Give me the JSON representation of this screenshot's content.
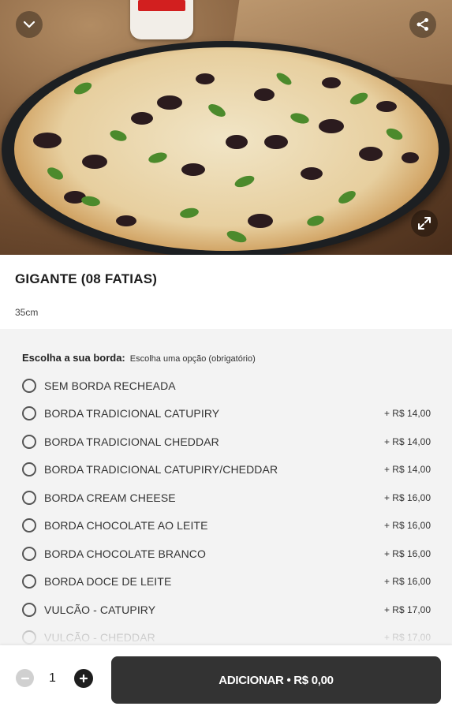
{
  "hero": {
    "image_alt": "Pizza",
    "back_icon": "chevron-down-icon",
    "share_icon": "share-icon",
    "expand_icon": "expand-icon"
  },
  "product": {
    "title": "GIGANTE (08 FATIAS)",
    "description": "35cm"
  },
  "option_group": {
    "title": "Escolha a sua borda:",
    "subtitle": "Escolha uma opção (obrigatório)",
    "options": [
      {
        "label": "SEM BORDA RECHEADA",
        "price": ""
      },
      {
        "label": "BORDA TRADICIONAL CATUPIRY",
        "price": "+ R$ 14,00"
      },
      {
        "label": "BORDA TRADICIONAL CHEDDAR",
        "price": "+ R$ 14,00"
      },
      {
        "label": "BORDA TRADICIONAL CATUPIRY/CHEDDAR",
        "price": "+ R$ 14,00"
      },
      {
        "label": "BORDA CREAM CHEESE",
        "price": "+ R$ 16,00"
      },
      {
        "label": "BORDA CHOCOLATE AO LEITE",
        "price": "+ R$ 16,00"
      },
      {
        "label": "BORDA CHOCOLATE BRANCO",
        "price": "+ R$ 16,00"
      },
      {
        "label": "BORDA DOCE DE LEITE",
        "price": "+ R$ 16,00"
      },
      {
        "label": "VULCÃO - CATUPIRY",
        "price": "+ R$ 17,00"
      },
      {
        "label": "VULCÃO - CHEDDAR",
        "price": "+ R$ 17,00"
      }
    ]
  },
  "cart": {
    "quantity": "1",
    "add_label": "ADICIONAR • R$ 0,00",
    "minus_icon": "minus-icon",
    "plus_icon": "plus-icon"
  },
  "colors": {
    "button_bg": "#333333",
    "options_bg": "#f3f3f3",
    "minus_disabled": "#d0d0d0"
  }
}
